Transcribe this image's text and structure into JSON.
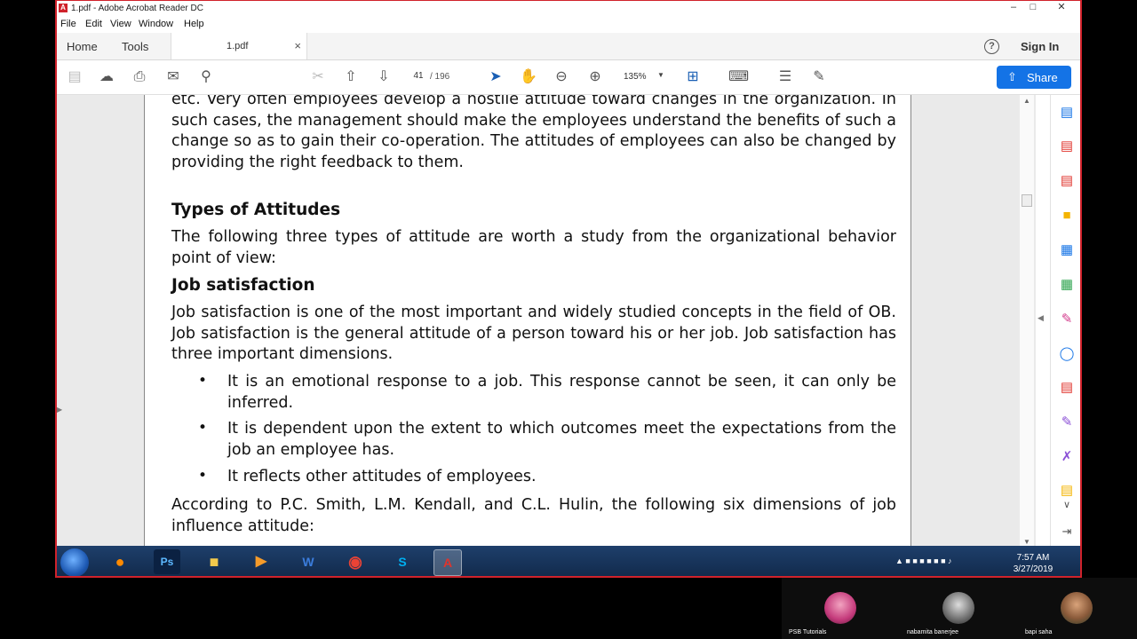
{
  "window": {
    "title": "1.pdf - Adobe Acrobat Reader DC",
    "accent": "#d0222b"
  },
  "menu": {
    "file": "File",
    "edit": "Edit",
    "view": "View",
    "window": "Window",
    "help": "Help"
  },
  "tabs": {
    "home": "Home",
    "tools": "Tools",
    "doc": "1.pdf",
    "signin": "Sign In"
  },
  "toolbar": {
    "page_current": "41",
    "page_total": "/ 196",
    "zoom": "135%",
    "share": "Share",
    "share_color": "#1473e6"
  },
  "document": {
    "para1": "etc. Very often employees develop a hostile attitude toward changes in the organization. In such cases, the management should make the employees understand the benefits of such a change so as to gain their co-operation. The attitudes of employees can also be changed by providing the right feedback to them.",
    "heading1": "Types of Attitudes",
    "para2": "The following three types of attitude are worth a study from the organizational behavior point of view:",
    "heading2": "Job satisfaction",
    "para3": "Job satisfaction is one of the most important and widely studied concepts in the field of OB. Job satisfaction is the general attitude of a person toward his or her job. Job satisfaction has three important dimensions.",
    "bullets": [
      "It is an emotional response to a job. This response cannot be seen, it can only be inferred.",
      "It is dependent upon the extent to which outcomes meet the expectations from the job an employee has.",
      "It reflects other attitudes of employees."
    ],
    "para4": "According to P.C. Smith, L.M. Kendall, and C.L. Hulin, the following six dimensions of job influence attitude:"
  },
  "taskbar": {
    "time": "7:57 AM",
    "date": "3/27/2019",
    "apps": [
      "firefox-icon",
      "photoshop-icon",
      "explorer-icon",
      "media-icon",
      "word-icon",
      "chrome-icon",
      "skype-icon",
      "acrobat-icon"
    ]
  },
  "participants": [
    {
      "name": "PSB Tutorials"
    },
    {
      "name": "nabamita banerjee"
    },
    {
      "name": "bapi saha"
    }
  ]
}
